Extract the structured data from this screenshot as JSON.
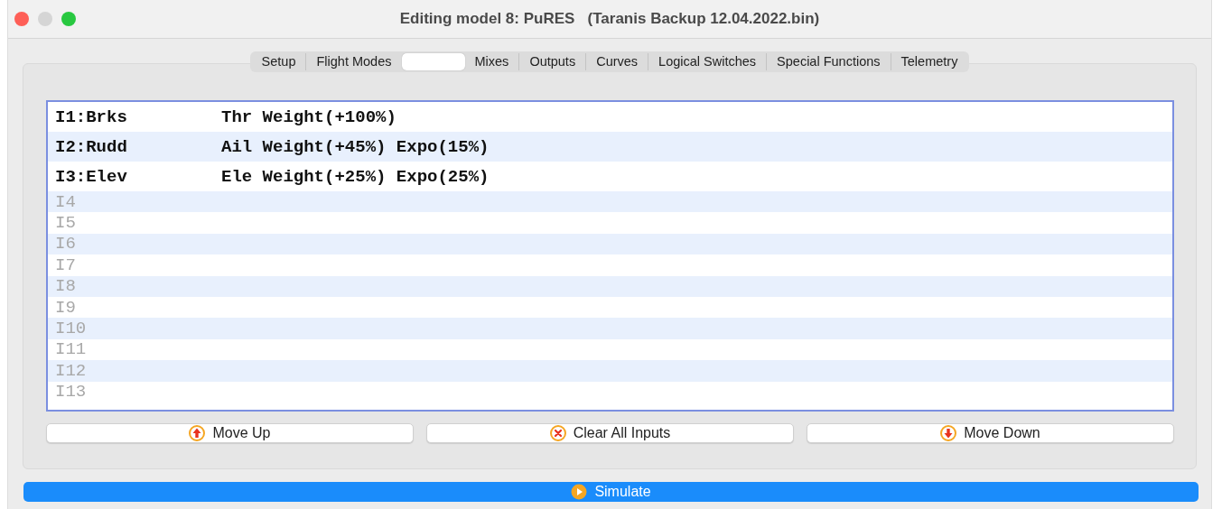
{
  "window": {
    "title": "Editing model 8: PuRES   (Taranis Backup 12.04.2022.bin)"
  },
  "tabs": [
    {
      "label": "Setup",
      "selected": false
    },
    {
      "label": "Flight Modes",
      "selected": false
    },
    {
      "selected": true
    },
    {
      "label": "Mixes",
      "selected": false
    },
    {
      "label": "Outputs",
      "selected": false
    },
    {
      "label": "Curves",
      "selected": false
    },
    {
      "label": "Logical Switches",
      "selected": false
    },
    {
      "label": "Special Functions",
      "selected": false
    },
    {
      "label": "Telemetry",
      "selected": false
    }
  ],
  "inputs": [
    {
      "name": "I1:Brks",
      "description": "Thr Weight(+100%)",
      "empty": false
    },
    {
      "name": "I2:Rudd",
      "description": "Ail Weight(+45%) Expo(15%)",
      "empty": false
    },
    {
      "name": "I3:Elev",
      "description": "Ele Weight(+25%) Expo(25%)",
      "empty": false
    },
    {
      "name": "I4",
      "empty": true
    },
    {
      "name": "I5",
      "empty": true
    },
    {
      "name": "I6",
      "empty": true
    },
    {
      "name": "I7",
      "empty": true
    },
    {
      "name": "I8",
      "empty": true
    },
    {
      "name": "I9",
      "empty": true
    },
    {
      "name": "I10",
      "empty": true
    },
    {
      "name": "I11",
      "empty": true
    },
    {
      "name": "I12",
      "empty": true
    },
    {
      "name": "I13",
      "empty": true
    }
  ],
  "buttons": [
    {
      "label": "Move Up",
      "kind": "up"
    },
    {
      "label": "Clear All Inputs",
      "kind": "clear"
    },
    {
      "label": "Move Down",
      "kind": "down"
    }
  ],
  "simulate_button": {
    "label": "Simulate"
  }
}
